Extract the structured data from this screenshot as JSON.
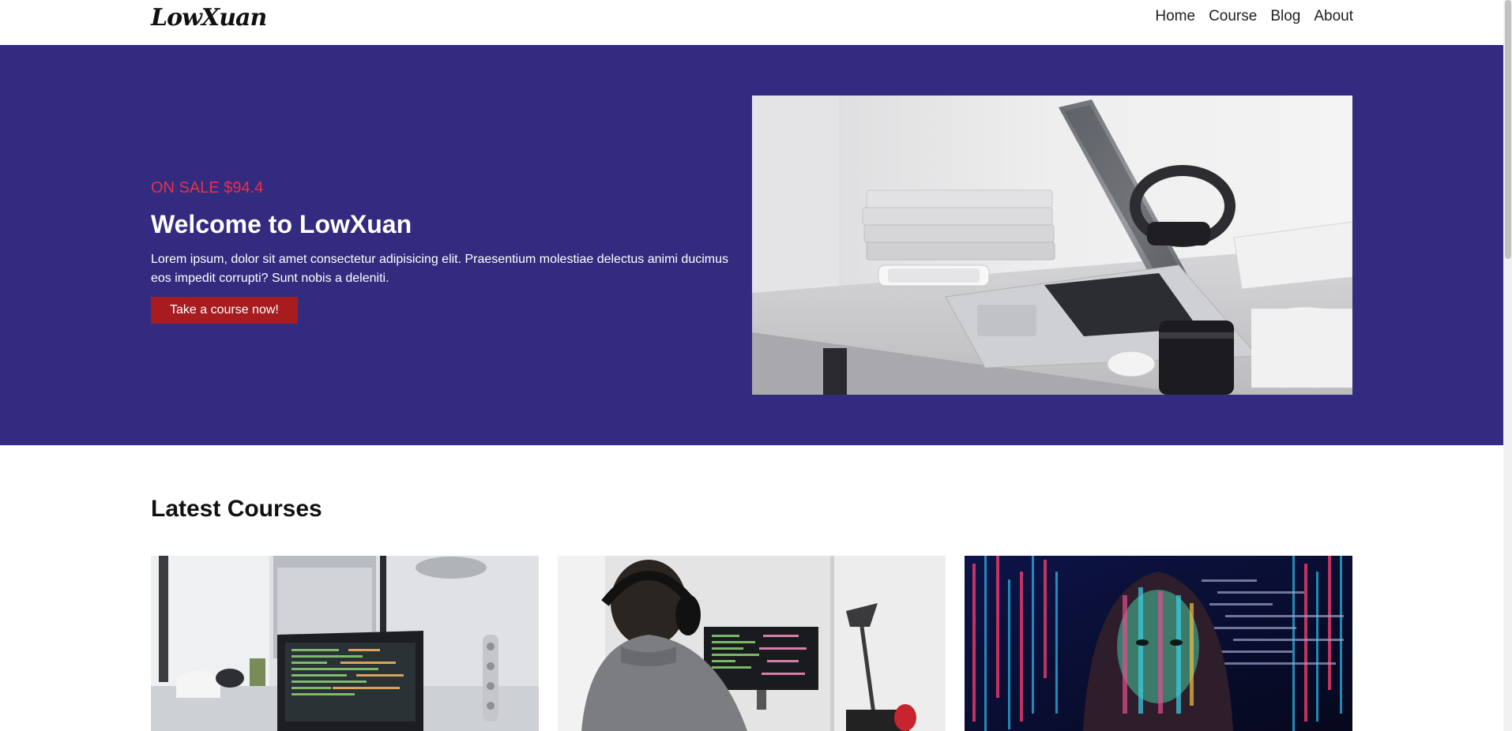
{
  "brand": {
    "logo_text": "LowXuan"
  },
  "nav": {
    "items": [
      "Home",
      "Course",
      "Blog",
      "About"
    ]
  },
  "hero": {
    "sale_text": "ON SALE $94.4",
    "title": "Welcome to LowXuan",
    "description": "Lorem ipsum, dolor sit amet consectetur adipisicing elit. Praesentium molestiae delectus animi ducimus eos impedit corrupti? Sunt nobis a deleniti.",
    "cta_label": "Take a course now!",
    "background_color": "#322b7f",
    "sale_color": "#e8304a",
    "cta_color": "#a61c1f"
  },
  "courses": {
    "title": "Latest Courses"
  }
}
